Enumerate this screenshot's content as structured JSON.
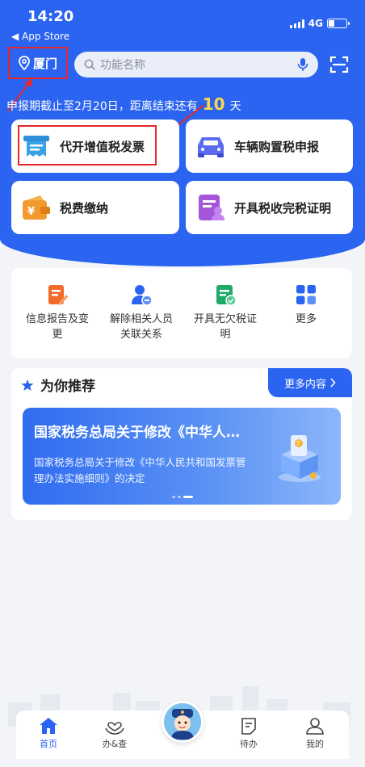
{
  "status": {
    "time": "14:20",
    "back_app": "◀ App Store",
    "network": "4G"
  },
  "header": {
    "city": "厦门",
    "search_placeholder": "功能名称",
    "deadline_prefix": "申报期截止至2月20日，距离结束还有",
    "deadline_days": "10",
    "deadline_suffix": "天"
  },
  "cards": [
    {
      "label": "代开增值税发票",
      "icon": "invoice-icon"
    },
    {
      "label": "车辆购置税申报",
      "icon": "car-icon"
    },
    {
      "label": "税费缴纳",
      "icon": "wallet-icon"
    },
    {
      "label": "开具税收完税证明",
      "icon": "certificate-icon"
    }
  ],
  "quick_actions": [
    {
      "label": "信息报告及变更",
      "icon": "report-edit-icon",
      "color": "#f26b2a"
    },
    {
      "label": "解除相关人员关联关系",
      "icon": "user-remove-icon",
      "color": "#2a64f0"
    },
    {
      "label": "开具无欠税证明",
      "icon": "document-check-icon",
      "color": "#1faa6b"
    },
    {
      "label": "更多",
      "icon": "grid-icon",
      "color": "#2a64f0"
    }
  ],
  "recommend": {
    "title": "为你推荐",
    "more": "更多内容",
    "banner_title": "国家税务总局关于修改《中华人…",
    "banner_desc": "国家税务总局关于修改《中华人民共和国发票管理办法实施细则》的决定"
  },
  "tabbar": [
    {
      "label": "首页",
      "icon": "home-icon"
    },
    {
      "label": "办&查",
      "icon": "heart-hands-icon"
    },
    {
      "label": "",
      "icon": "assistant-avatar-icon"
    },
    {
      "label": "待办",
      "icon": "todo-icon"
    },
    {
      "label": "我的",
      "icon": "person-icon"
    }
  ],
  "colors": {
    "primary": "#2a64f0",
    "highlight": "#e8262a",
    "accent_number": "#ffd84a"
  }
}
